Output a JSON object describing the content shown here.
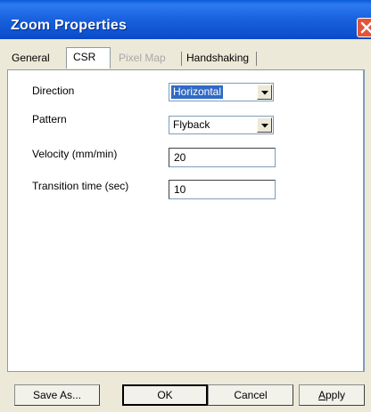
{
  "window": {
    "title": "Zoom Properties"
  },
  "tabs": [
    {
      "label": "General"
    },
    {
      "label": "CSR"
    },
    {
      "label": "Pixel Map"
    },
    {
      "label": "Handshaking"
    }
  ],
  "form": {
    "direction": {
      "label": "Direction",
      "value": "Horizontal"
    },
    "pattern": {
      "label": "Pattern",
      "value": "Flyback"
    },
    "velocity": {
      "label": "Velocity (mm/min)",
      "value": "20"
    },
    "transition": {
      "label": "Transition time (sec)",
      "value": "10"
    }
  },
  "buttons": {
    "save_as": "Save As...",
    "ok": "OK",
    "cancel": "Cancel",
    "apply_first": "A",
    "apply_rest": "pply"
  },
  "colors": {
    "titlebar": "#0d52cf",
    "selection": "#316ac5",
    "close": "#e2553d"
  },
  "icons": {
    "close": "close-icon",
    "dropdown": "chevron-down-icon"
  }
}
